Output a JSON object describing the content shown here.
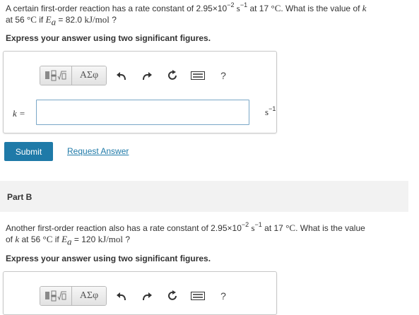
{
  "partA": {
    "q_1": "A certain first-order reaction has a rate constant of 2.95×10",
    "q_exp1": "−2",
    "q_unit1": "s",
    "q_unit1_exp": "−1",
    "q_2": "at 17",
    "q_deg": "°C",
    "q_3": ". What is the value of",
    "q_var": "k",
    "q_4": "at 56",
    "q_deg2": "°C",
    "q_5": "if",
    "q_Ea": "E",
    "q_Ea_sub": "a",
    "q_6": "= 82.0",
    "q_7": "kJ/mol",
    "q_8": "?",
    "instruction": "Express your answer using two significant figures.",
    "k_label": "k =",
    "unit": "s",
    "unit_exp": "−1",
    "submit_label": "Submit",
    "request_label": "Request Answer",
    "answer_value": ""
  },
  "toolbar": {
    "template_icon": "template-icon",
    "greek_label": "ΑΣφ",
    "undo_icon": "undo-icon",
    "redo_icon": "redo-icon",
    "reset_icon": "reset-icon",
    "keyboard_icon": "keyboard-icon",
    "help_label": "?"
  },
  "partB": {
    "title": "Part B",
    "q_1": "Another first-order reaction also has a rate constant of 2.95×10",
    "q_exp1": "−2",
    "q_unit1": "s",
    "q_unit1_exp": "−1",
    "q_2": "at 17",
    "q_deg": "°C",
    "q_3": ". What is the value",
    "q_3b": "of",
    "q_var": "k",
    "q_4": "at 56",
    "q_deg2": "°C",
    "q_5": "if",
    "q_Ea": "E",
    "q_Ea_sub": "a",
    "q_6": "= 120",
    "q_7": "kJ/mol",
    "q_8": "?",
    "instruction": "Express your answer using two significant figures."
  },
  "colors": {
    "accent": "#1f7aa8",
    "band": "#f2f2f2",
    "input_border": "#7aa7c7"
  }
}
